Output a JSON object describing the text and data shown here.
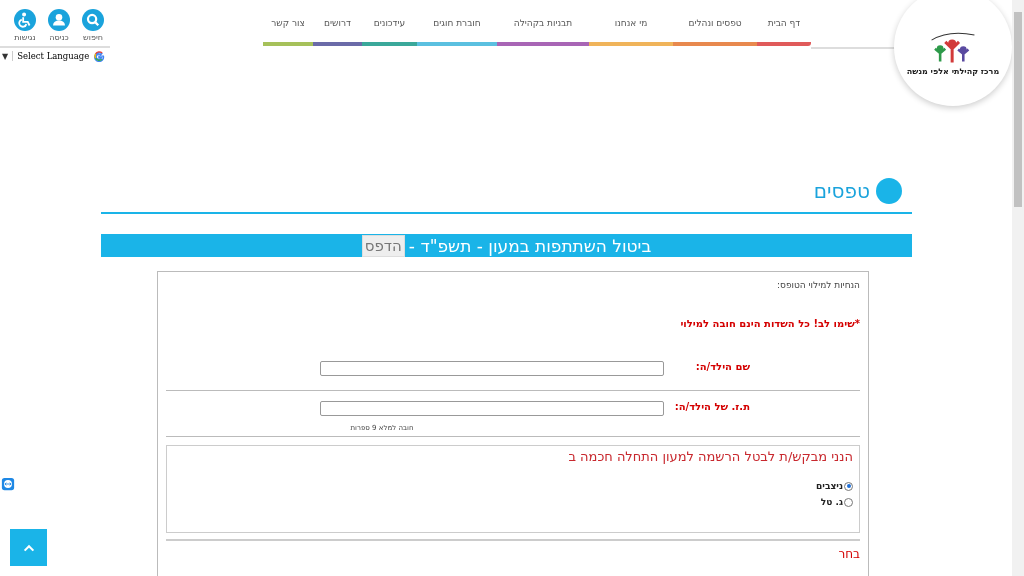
{
  "header": {
    "logo_caption": "מרכז קהילתי אלפי מנשה",
    "nav": [
      {
        "label": "דף הבית",
        "color": "#e05a5a"
      },
      {
        "label": "טפסים ונהלים",
        "color": "#e8894e"
      },
      {
        "label": "מי אנחנו",
        "color": "#f0b45a"
      },
      {
        "label": "תבניות בקהילה",
        "color": "#a865b5"
      },
      {
        "label": "חוברת חוגים",
        "color": "#5bc0e0"
      },
      {
        "label": "עידכונים",
        "color": "#3aa89a"
      },
      {
        "label": "דרושים",
        "color": "#6b6ba8"
      },
      {
        "label": "צור קשר",
        "color": "#a6c15a"
      }
    ],
    "tools": [
      {
        "kind": "search",
        "label": "חיפוש"
      },
      {
        "kind": "login",
        "label": "כניסה"
      },
      {
        "kind": "accessibility",
        "label": "נגישות"
      }
    ],
    "language": {
      "label": "Select Language",
      "arrow": "▼"
    }
  },
  "page_title": "טפסים",
  "form": {
    "title": "ביטול השתתפות במעון - תשפ\"ד -",
    "print_button": "הדפס",
    "instructions": "הנחיות למילוי הטופס:",
    "notice": "*שימו לב! כל השדות הינם חובה למילוי",
    "fields": [
      {
        "label": "שם הילד/ה:"
      },
      {
        "label": "ת.ז. של הילד/ה:",
        "hint": "חובה למלא 9 ספרות"
      }
    ],
    "request": {
      "legend": "הנני מבקש/ת לבטל הרשמה למעון התחלה חכמה ב",
      "options": [
        {
          "label": "ניצבים",
          "selected": true
        },
        {
          "label": "ג. טל",
          "selected": false
        }
      ]
    },
    "next_label": "בחר"
  }
}
